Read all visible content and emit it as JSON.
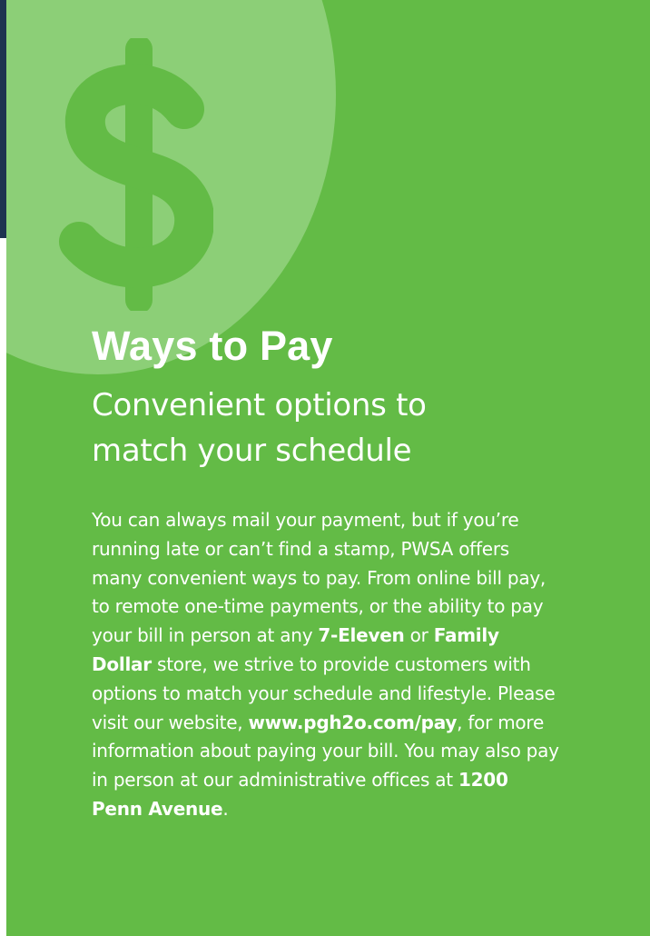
{
  "header": {
    "title": "Ways to Pay",
    "subtitle_line1": "Convenient options to",
    "subtitle_line2": "match your schedule"
  },
  "body": {
    "text_1": "You can always mail your payment, but if you’re running late or can’t find a stamp, PWSA offers many convenient ways to pay. From online bill pay, to remote one-time payments, or the ability to pay your bill in person at any ",
    "store_1": "7-Eleven",
    "text_2": " or ",
    "store_2": "Family Dollar",
    "text_3": " store, we strive to provide customers with options to match your schedule and lifestyle. Please visit our website, ",
    "website": "www.pgh2o.com/pay",
    "text_4": ", for more information about paying your bill. You may also pay in person at our administrative offices at ",
    "address": "1200 Penn Avenue",
    "text_5": "."
  },
  "colors": {
    "panel_green": "#63bb46",
    "coin_green": "#8ccf77",
    "dollar_green": "#63bb46",
    "strip_navy": "#1e3350",
    "text": "#ffffff"
  },
  "icons": {
    "hero": "dollar-sign-icon"
  }
}
